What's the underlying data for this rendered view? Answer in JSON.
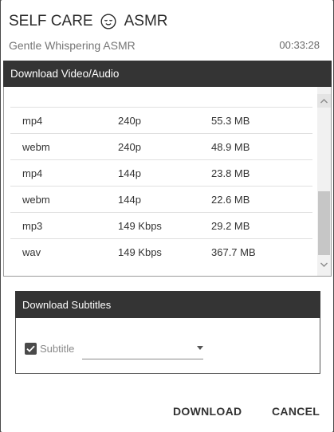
{
  "dialog": {
    "title_left": "SELF CARE",
    "title_right": "ASMR",
    "title_emoji_icon": "relieved-face-icon",
    "subtitle": "Gentle Whispering ASMR",
    "duration": "00:33:28"
  },
  "download_panel": {
    "heading": "Download Video/Audio",
    "rows": [
      {
        "format": "mp4",
        "quality": "240p",
        "size": "55.3 MB"
      },
      {
        "format": "webm",
        "quality": "240p",
        "size": "48.9 MB"
      },
      {
        "format": "mp4",
        "quality": "144p",
        "size": "23.8 MB"
      },
      {
        "format": "webm",
        "quality": "144p",
        "size": "22.6 MB"
      },
      {
        "format": "mp3",
        "quality": "149 Kbps",
        "size": "29.2 MB"
      },
      {
        "format": "wav",
        "quality": "149 Kbps",
        "size": "367.7 MB"
      }
    ]
  },
  "subtitles_panel": {
    "heading": "Download Subtitles",
    "checkbox_label": "Subtitle",
    "checked": true,
    "selected_value": ""
  },
  "actions": {
    "download_label": "DOWNLOAD",
    "cancel_label": "CANCEL"
  }
}
